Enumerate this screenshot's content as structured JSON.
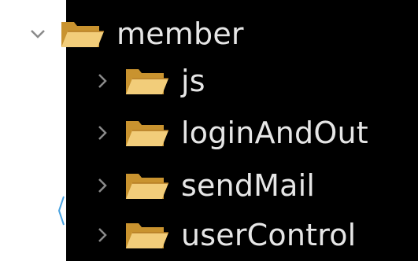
{
  "tree": {
    "root": {
      "label": "member",
      "expanded": true,
      "chevron_icon": "chevron-down-icon",
      "folder_icon": "folder-open-icon"
    },
    "children": [
      {
        "label": "js",
        "expanded": false,
        "chevron_icon": "chevron-right-icon",
        "folder_icon": "folder-open-icon"
      },
      {
        "label": "loginAndOut",
        "expanded": false,
        "chevron_icon": "chevron-right-icon",
        "folder_icon": "folder-open-icon"
      },
      {
        "label": "sendMail",
        "expanded": false,
        "chevron_icon": "chevron-right-icon",
        "folder_icon": "folder-open-icon"
      },
      {
        "label": "userControl",
        "expanded": false,
        "chevron_icon": "chevron-right-icon",
        "folder_icon": "folder-open-icon"
      }
    ]
  },
  "colors": {
    "background": "#000000",
    "text": "#e6e6e6",
    "chevron": "#8a8a8a",
    "folder_back": "#c9932f",
    "folder_front": "#f2cd7a",
    "outer_background": "#ffffff"
  }
}
